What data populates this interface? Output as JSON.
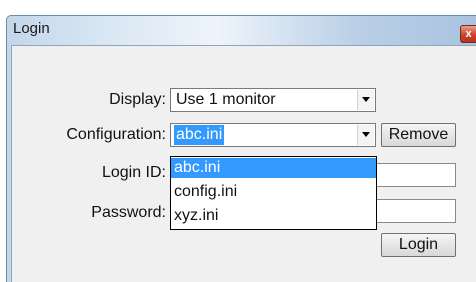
{
  "window": {
    "title": "Login",
    "close_glyph": "x"
  },
  "form": {
    "display_label": "Display:",
    "display_value": "Use 1 monitor",
    "configuration_label": "Configuration:",
    "configuration_value": "abc.ini",
    "remove_button": "Remove",
    "login_id_label": "Login ID:",
    "password_label": "Password:",
    "login_button": "Login"
  },
  "configuration_dropdown": {
    "options": [
      "abc.ini",
      "config.ini",
      "xyz.ini"
    ],
    "highlighted": "abc.ini"
  },
  "icons": {
    "close": "close-icon",
    "dropdown": "chevron-down-icon"
  },
  "colors": {
    "selection": "#3399ff",
    "close_button": "#c9452e"
  }
}
